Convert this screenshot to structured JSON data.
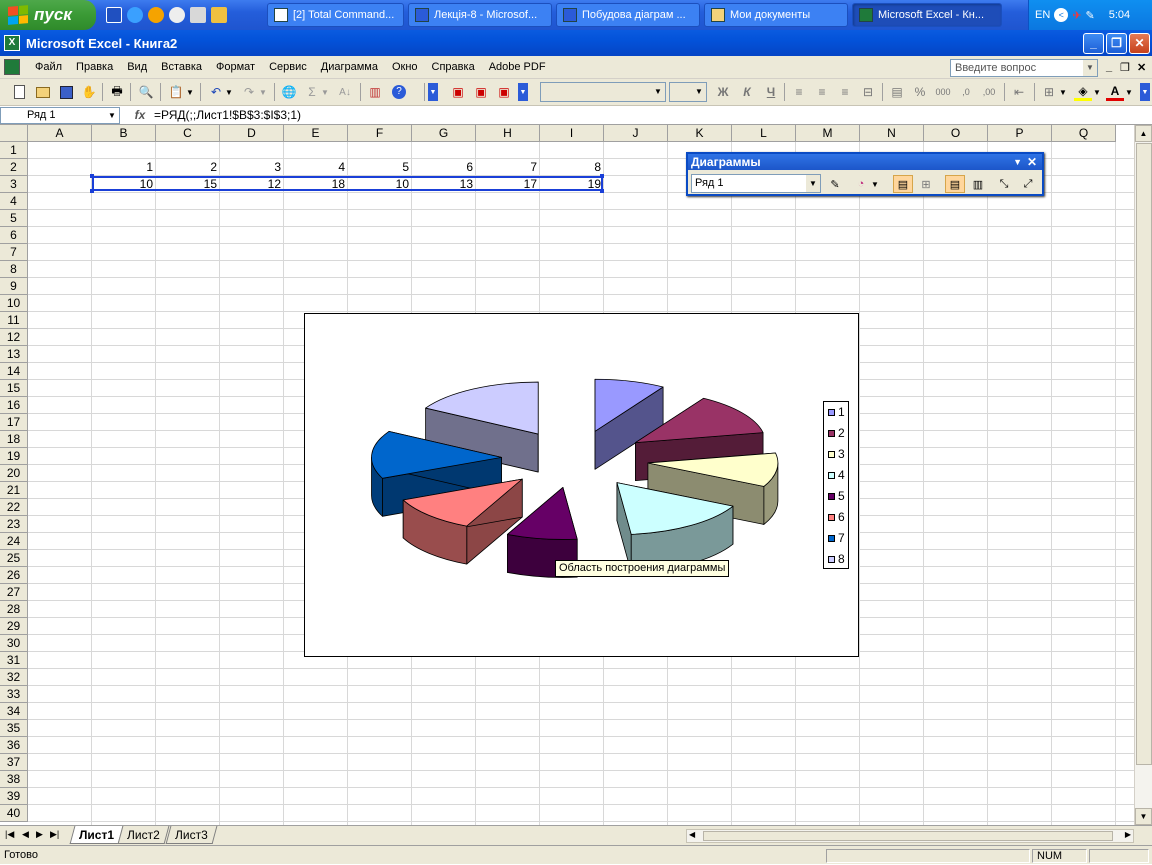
{
  "taskbar": {
    "start_label": "пуск",
    "buttons": [
      {
        "label": "[2] Total Command..."
      },
      {
        "label": "Лекція-8 - Microsof..."
      },
      {
        "label": "Побудова діаграм ..."
      },
      {
        "label": "Мои документы"
      },
      {
        "label": "Microsoft Excel - Кн..."
      }
    ],
    "lang": "EN",
    "clock": "5:04"
  },
  "window": {
    "title": "Microsoft Excel - Книга2"
  },
  "menu": {
    "items": [
      "Файл",
      "Правка",
      "Вид",
      "Вставка",
      "Формат",
      "Сервис",
      "Диаграмма",
      "Окно",
      "Справка",
      "Adobe PDF"
    ],
    "ask_placeholder": "Введите вопрос"
  },
  "toolbar": {
    "bold": "Ж",
    "italic": "К",
    "underline": "Ч",
    "sigma": "Σ",
    "percent": "%",
    "thousands": "000",
    "inc_dec": ",0",
    "dec_dec": ",00"
  },
  "formula_bar": {
    "name_box": "Ряд 1",
    "fx": "fx",
    "formula": "=РЯД(;;Лист1!$B$3:$I$3;1)"
  },
  "columns": [
    "A",
    "B",
    "C",
    "D",
    "E",
    "F",
    "G",
    "H",
    "I",
    "J",
    "K",
    "L",
    "M",
    "N",
    "O",
    "P",
    "Q"
  ],
  "rows": [
    "1",
    "2",
    "3",
    "4",
    "5",
    "6",
    "7",
    "8",
    "9",
    "10",
    "11",
    "12",
    "13",
    "14",
    "15",
    "16",
    "17",
    "18",
    "19",
    "20",
    "21",
    "22",
    "23",
    "24",
    "25",
    "26",
    "27",
    "28",
    "29",
    "30",
    "31",
    "32",
    "33",
    "34",
    "35",
    "36",
    "37",
    "38",
    "39",
    "40"
  ],
  "cells": {
    "row2": [
      "1",
      "2",
      "3",
      "4",
      "5",
      "6",
      "7",
      "8"
    ],
    "row3": [
      "10",
      "15",
      "12",
      "18",
      "10",
      "13",
      "17",
      "19"
    ]
  },
  "chart_data": {
    "type": "pie",
    "variant": "exploded-3d",
    "categories": [
      "1",
      "2",
      "3",
      "4",
      "5",
      "6",
      "7",
      "8"
    ],
    "values": [
      10,
      15,
      12,
      18,
      10,
      13,
      17,
      19
    ],
    "colors": [
      "#9999ff",
      "#993366",
      "#ffffcc",
      "#ccffff",
      "#660066",
      "#ff8080",
      "#0066cc",
      "#ccccff"
    ],
    "legend_position": "right",
    "title": ""
  },
  "chart_tooltip": "Область построения диаграммы",
  "chart_toolbar": {
    "title": "Диаграммы",
    "selected": "Ряд 1"
  },
  "sheets": [
    {
      "label": "Лист1",
      "active": true
    },
    {
      "label": "Лист2",
      "active": false
    },
    {
      "label": "Лист3",
      "active": false
    }
  ],
  "status": {
    "text": "Готово",
    "num": "NUM"
  }
}
